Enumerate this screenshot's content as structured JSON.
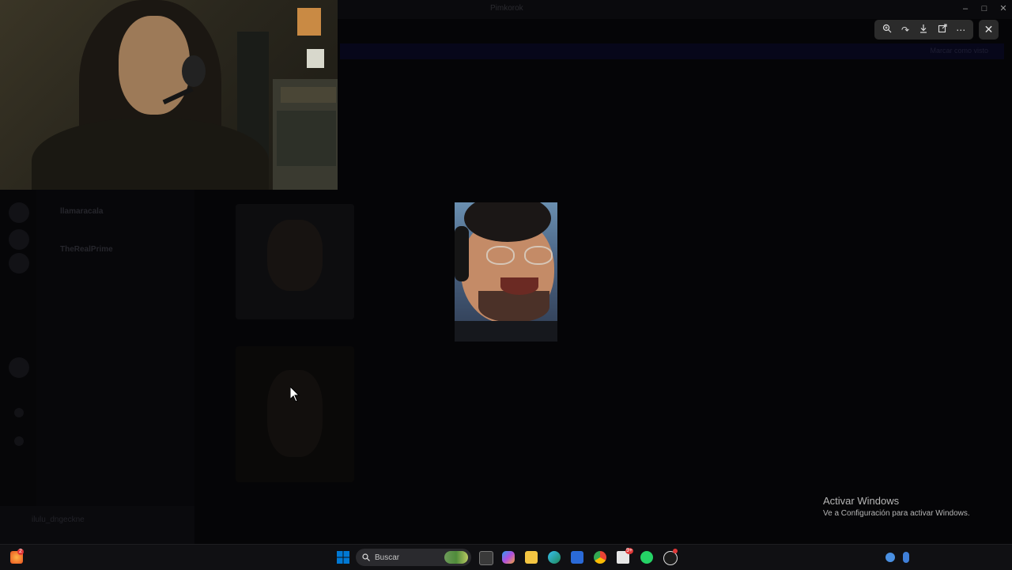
{
  "background_app": {
    "title": "Pimkorok",
    "toolbar_text": "",
    "banner_text": "Marcar como visto",
    "channels": [
      {
        "label": "llamaracala",
        "bold": true
      },
      {
        "label": "TheRealPrime",
        "bold": true
      },
      {
        "label": "",
        "bold": false
      },
      {
        "label": "",
        "bold": false
      },
      {
        "label": "",
        "bold": false
      }
    ],
    "user_name": "ilulu_dngeckne"
  },
  "viewer": {
    "toolbar": {
      "zoom_icon": "zoom-in-icon",
      "rotate_icon": "rotate-icon",
      "download_icon": "download-icon",
      "open_icon": "open-external-icon",
      "more_icon": "more-icon",
      "close_icon": "close-icon"
    }
  },
  "window_controls": {
    "minimize": "–",
    "maximize": "□",
    "close": "✕"
  },
  "watermark": {
    "title": "Activar Windows",
    "subtitle": "Ve a Configuración para activar Windows."
  },
  "taskbar": {
    "search_placeholder": "Buscar",
    "left_badge": "2",
    "notes_badge": "9+",
    "accent": "#0078d4"
  }
}
